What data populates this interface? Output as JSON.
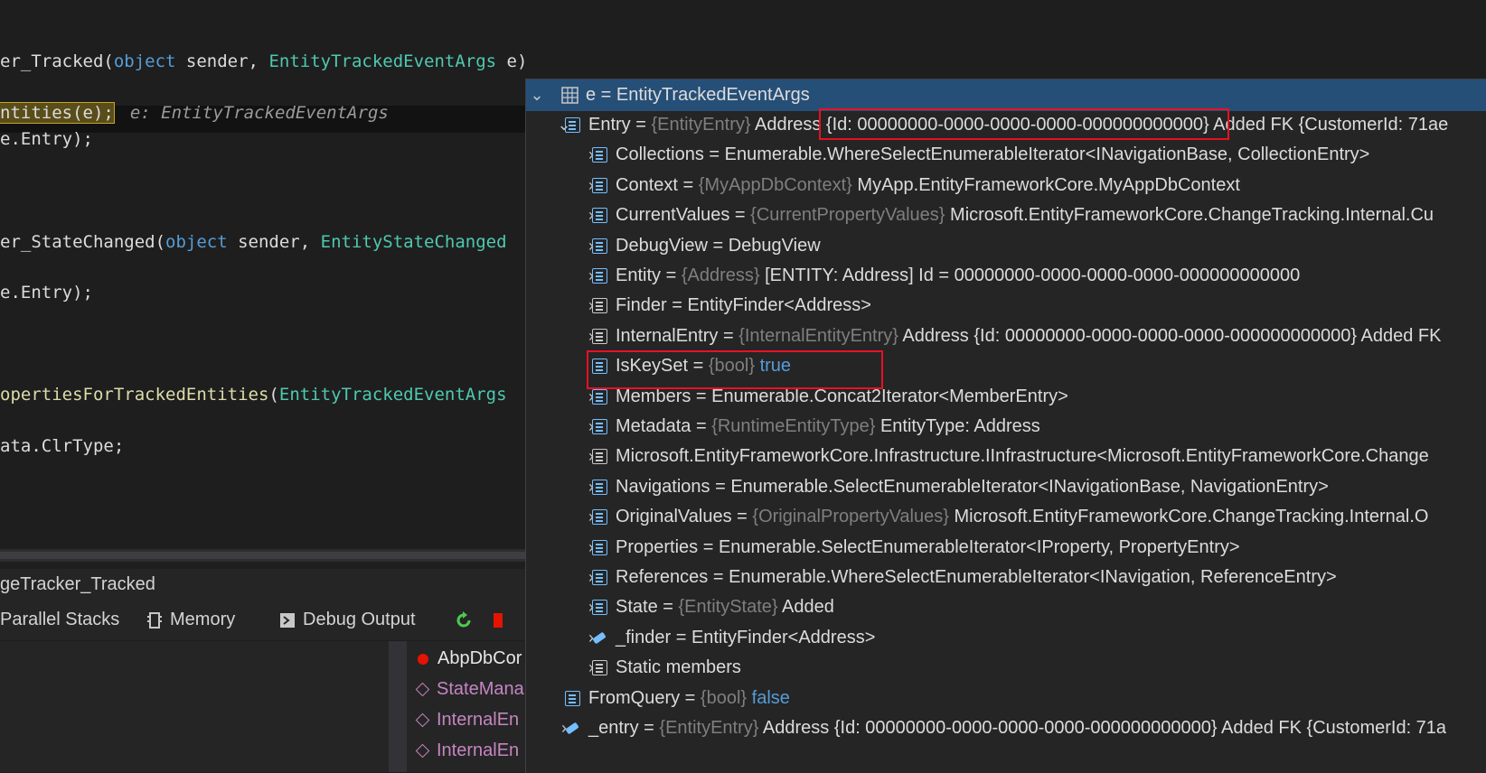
{
  "editor": {
    "lines": [
      {
        "parts": [
          [
            "er_Tracked(",
            ""
          ],
          [
            "object",
            "kw"
          ],
          [
            " sender, ",
            ""
          ],
          [
            "EntityTrackedEventArgs",
            "ty"
          ],
          [
            " e)",
            ""
          ]
        ]
      },
      {
        "parts": [
          [
            "ntities(e);",
            "hl"
          ]
        ],
        "hint": "e: EntityTrackedEventArgs"
      },
      {
        "parts": [
          [
            "e.Entry);",
            ""
          ]
        ]
      },
      {
        "parts": [
          [
            "er_StateChanged(",
            ""
          ],
          [
            "object",
            "kw"
          ],
          [
            " sender, ",
            ""
          ],
          [
            "EntityStateChanged",
            "ty"
          ]
        ]
      },
      {
        "parts": [
          [
            "e.Entry);",
            ""
          ]
        ]
      },
      {
        "parts": [
          [
            "opertiesForTrackedEntities",
            "fn"
          ],
          [
            "(",
            ""
          ],
          [
            "EntityTrackedEventArgs",
            "ty"
          ]
        ]
      },
      {
        "parts": [
          [
            "ata.ClrType;",
            ""
          ]
        ]
      }
    ]
  },
  "breadcrumb": "geTracker_Tracked",
  "toolbar": {
    "items": [
      {
        "label": "Parallel Stacks",
        "icon": "parallel-stacks-icon"
      },
      {
        "label": "Memory",
        "icon": "memory-icon"
      },
      {
        "label": "Debug Output",
        "icon": "debug-output-icon"
      }
    ],
    "refresh_icon": "refresh-icon",
    "stop_icon": "stop-icon"
  },
  "callstack": [
    {
      "label": "AbpDbCor",
      "kind": "current",
      "color": "#e51400"
    },
    {
      "label": "StateMana",
      "kind": "frame"
    },
    {
      "label": "InternalEn",
      "kind": "frame"
    },
    {
      "label": "InternalEn",
      "kind": "frame"
    }
  ],
  "datatip": {
    "root": {
      "name": "e",
      "value": "EntityTrackedEventArgs",
      "icon": "table-icon"
    },
    "rows": [
      {
        "level": 1,
        "expand": "open",
        "name": "Entry",
        "type": "{EntityEntry}",
        "value": "Address {Id: 00000000-0000-0000-0000-000000000000} Added FK {CustomerId: 71ae",
        "icon": "property-icon"
      },
      {
        "level": 2,
        "expand": "closed",
        "name": "Collections",
        "type": "",
        "value": "Enumerable.WhereSelectEnumerableIterator<INavigationBase, CollectionEntry>",
        "icon": "property-icon"
      },
      {
        "level": 2,
        "expand": "closed",
        "name": "Context",
        "type": "{MyAppDbContext}",
        "value": "MyApp.EntityFrameworkCore.MyAppDbContext",
        "icon": "property-icon"
      },
      {
        "level": 2,
        "expand": "closed",
        "name": "CurrentValues",
        "type": "{CurrentPropertyValues}",
        "value": "Microsoft.EntityFrameworkCore.ChangeTracking.Internal.Cu",
        "icon": "property-icon"
      },
      {
        "level": 2,
        "expand": "closed",
        "name": "DebugView",
        "type": "",
        "value": "DebugView",
        "icon": "property-icon"
      },
      {
        "level": 2,
        "expand": "closed",
        "name": "Entity",
        "type": "{Address}",
        "value": "[ENTITY: Address] Id = 00000000-0000-0000-0000-000000000000",
        "icon": "property-icon"
      },
      {
        "level": 2,
        "expand": "closed",
        "name": "Finder",
        "type": "",
        "value": "EntityFinder<Address>",
        "icon": "private-property-icon"
      },
      {
        "level": 2,
        "expand": "closed",
        "name": "InternalEntry",
        "type": "{InternalEntityEntry}",
        "value": "Address {Id: 00000000-0000-0000-0000-000000000000} Added FK",
        "icon": "private-property-icon"
      },
      {
        "level": 2,
        "expand": "none",
        "name": "IsKeySet",
        "type": "{bool}",
        "value": "true",
        "bool": true,
        "icon": "property-icon"
      },
      {
        "level": 2,
        "expand": "closed",
        "name": "Members",
        "type": "",
        "value": "Enumerable.Concat2Iterator<MemberEntry>",
        "icon": "property-icon"
      },
      {
        "level": 2,
        "expand": "closed",
        "name": "Metadata",
        "type": "{RuntimeEntityType}",
        "value": "EntityType: Address",
        "icon": "property-icon"
      },
      {
        "level": 2,
        "expand": "closed",
        "name": "Microsoft.EntityFrameworkCore.Infrastructure.IInfrastructure<Microsoft.EntityFrameworkCore.Change",
        "type": "",
        "value": "",
        "icon": "private-property-icon",
        "noeq": true
      },
      {
        "level": 2,
        "expand": "closed",
        "name": "Navigations",
        "type": "",
        "value": "Enumerable.SelectEnumerableIterator<INavigationBase, NavigationEntry>",
        "icon": "property-icon"
      },
      {
        "level": 2,
        "expand": "closed",
        "name": "OriginalValues",
        "type": "{OriginalPropertyValues}",
        "value": "Microsoft.EntityFrameworkCore.ChangeTracking.Internal.O",
        "icon": "property-icon"
      },
      {
        "level": 2,
        "expand": "closed",
        "name": "Properties",
        "type": "",
        "value": "Enumerable.SelectEnumerableIterator<IProperty, PropertyEntry>",
        "icon": "property-icon"
      },
      {
        "level": 2,
        "expand": "closed",
        "name": "References",
        "type": "",
        "value": "Enumerable.WhereSelectEnumerableIterator<INavigation, ReferenceEntry>",
        "icon": "property-icon"
      },
      {
        "level": 2,
        "expand": "closed",
        "name": "State",
        "type": "{EntityState}",
        "value": "Added",
        "icon": "property-icon"
      },
      {
        "level": 2,
        "expand": "closed",
        "name": "_finder",
        "type": "",
        "value": "EntityFinder<Address>",
        "icon": "field-icon"
      },
      {
        "level": 2,
        "expand": "closed",
        "name": "Static members",
        "type": "",
        "value": "",
        "icon": "static-members-icon",
        "noeq": true
      },
      {
        "level": 1,
        "expand": "none",
        "name": "FromQuery",
        "type": "{bool}",
        "value": "false",
        "bool": true,
        "icon": "property-icon"
      },
      {
        "level": 1,
        "expand": "closed",
        "name": "_entry",
        "type": "{EntityEntry}",
        "value": "Address {Id: 00000000-0000-0000-0000-000000000000} Added FK {CustomerId: 71a",
        "icon": "field-icon"
      }
    ],
    "highlight_color": "#e81123"
  }
}
